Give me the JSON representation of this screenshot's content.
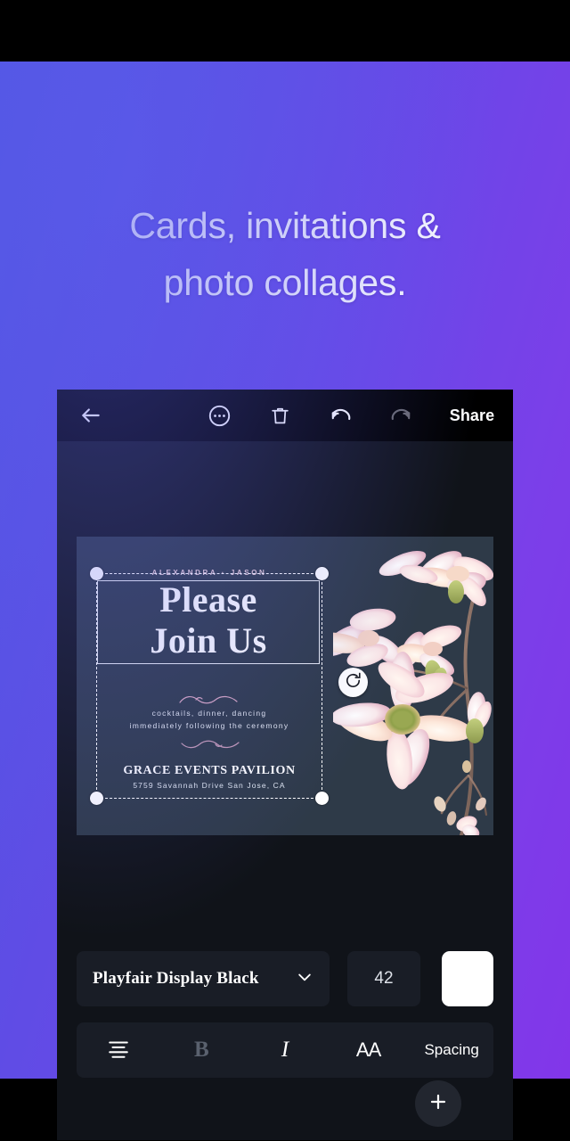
{
  "promo": {
    "headline_line1": "Cards, invitations &",
    "headline_line2": "photo collages.",
    "gradient_from": "#5154e2",
    "gradient_to": "#8236e9"
  },
  "toolbar": {
    "back_icon": "arrow-left-icon",
    "more_icon": "more-horizontal-circle-icon",
    "delete_icon": "trash-icon",
    "undo_icon": "undo-icon",
    "redo_icon": "redo-icon",
    "share_label": "Share"
  },
  "design": {
    "background_color": "#2e3a48",
    "names": "ALEXANDRA  ·  JASON",
    "title_line1": "Please",
    "title_line2": "Join Us",
    "detail_line1": "cocktails, dinner, dancing",
    "detail_line2": "immediately following the ceremony",
    "venue": "GRACE EVENTS PAVILION",
    "address": "5759 Savannah Drive San Jose, CA",
    "accent_color": "#e7ccd3",
    "rotate_icon": "rotate-icon"
  },
  "text_controls": {
    "font_name": "Playfair Display Black",
    "font_dropdown_icon": "chevron-down-icon",
    "font_size": "42",
    "color_swatch": "#ffffff",
    "align_icon": "align-center-icon",
    "bold_label": "B",
    "italic_label": "I",
    "case_label": "AA",
    "spacing_label": "Spacing"
  },
  "fab": {
    "add_icon": "plus-icon"
  }
}
